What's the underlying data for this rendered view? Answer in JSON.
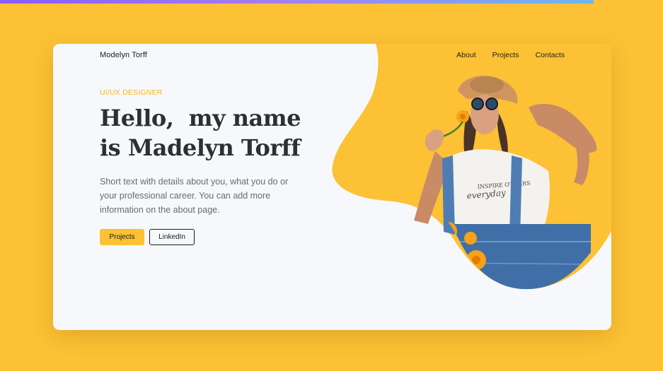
{
  "brand": {
    "name": "Modelyn Torff"
  },
  "nav": {
    "items": [
      "About",
      "Projects",
      "Contacts"
    ]
  },
  "hero": {
    "eyebrow": "UI/UX DESIGNER",
    "headline_line1": "Hello,  my name",
    "headline_line2": "is Madelyn Torff",
    "bio": "Short text with details about you, what you do or your professional career. You can add more information on the about page.",
    "buttons": {
      "primary": "Projects",
      "secondary": "LinkedIn"
    }
  },
  "portrait": {
    "shirt_text_top": "INSPIRE OTHERS",
    "shirt_text_bottom": "everyday"
  },
  "colors": {
    "background": "#fcc134",
    "accent": "#fcc134",
    "eyebrow": "#f5b619",
    "card": "#f6f8fc",
    "heading": "#2d2f33",
    "strip_start": "#8a5cf6",
    "strip_end": "#6fb6ef"
  }
}
